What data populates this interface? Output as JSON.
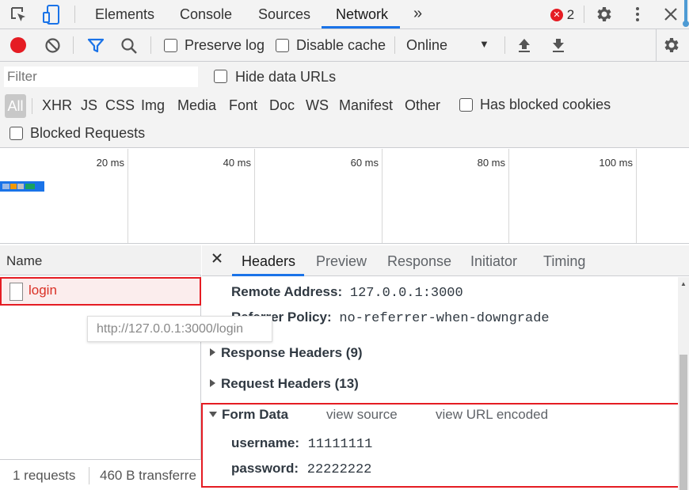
{
  "top_tabs": [
    {
      "label": "Elements"
    },
    {
      "label": "Console"
    },
    {
      "label": "Sources"
    },
    {
      "label": "Network"
    }
  ],
  "error_count": "2",
  "toolbar": {
    "preserve_log": "Preserve log",
    "disable_cache": "Disable cache",
    "throttling": "Online"
  },
  "filters": {
    "filter_placeholder": "Filter",
    "hide_data_urls": "Hide data URLs",
    "all": "All",
    "types": [
      "XHR",
      "JS",
      "CSS",
      "Img",
      "Media",
      "Font",
      "Doc",
      "WS",
      "Manifest",
      "Other"
    ],
    "has_blocked_cookies": "Has blocked cookies",
    "blocked_requests": "Blocked Requests"
  },
  "overview": {
    "ticks": [
      "20 ms",
      "40 ms",
      "60 ms",
      "80 ms",
      "100 ms"
    ]
  },
  "requests": {
    "header": "Name",
    "items": [
      {
        "name": "login"
      }
    ],
    "tooltip": "http://127.0.0.1:3000/login",
    "status_count": "1 requests",
    "status_transfer": "460 B transferre"
  },
  "detail": {
    "tabs": [
      "Headers",
      "Preview",
      "Response",
      "Initiator",
      "Timing"
    ],
    "remote_address_key": "Remote Address:",
    "remote_address_val": "127.0.0.1:3000",
    "referrer_policy_key": "Referrer Policy:",
    "referrer_policy_val": "no-referrer-when-downgrade",
    "response_headers": "Response Headers (9)",
    "request_headers": "Request Headers (13)",
    "form_data": {
      "title": "Form Data",
      "view_source": "view source",
      "view_url_encoded": "view URL encoded",
      "fields": [
        {
          "key": "username:",
          "value": "11111111"
        },
        {
          "key": "password:",
          "value": "22222222"
        }
      ]
    }
  },
  "colors": {
    "accent": "#1a73e8",
    "record": "#e51c23",
    "highlight_border": "#e51c23",
    "error_badge": "#e51c23"
  }
}
